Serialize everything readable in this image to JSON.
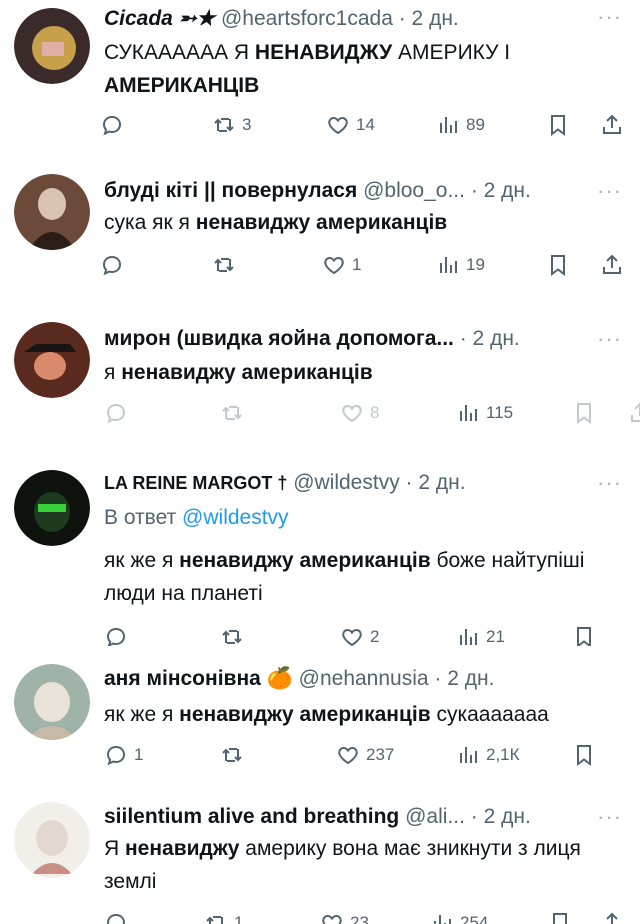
{
  "ui": {
    "more": "···"
  },
  "tweets": [
    {
      "name": "Cicada ➵★",
      "handle": "@heartsforc1cada",
      "time": "· 2 дн.",
      "text_parts": [
        "СУКАААААА Я ",
        "НЕНАВИДЖУ",
        " АМЕРИКУ І ",
        "АМЕРИКАНЦІВ",
        ""
      ],
      "replies": "",
      "retweets": "3",
      "likes": "14",
      "views": "89",
      "avatar_colors": [
        "#3b2a2a",
        "#c9a04a",
        "#e0b0a8"
      ]
    },
    {
      "name": "блуді кіті || повернулася",
      "handle": "@bloo_o...",
      "time": "· 2 дн.",
      "text_parts": [
        "сука як я ",
        "ненавиджу американців",
        ""
      ],
      "replies": "",
      "retweets": "",
      "likes": "1",
      "views": "19",
      "avatar_colors": [
        "#6b4a3a",
        "#d9c3b0",
        "#2b1e18"
      ]
    },
    {
      "name": "мирон (швидка яойна допомога...",
      "handle": "",
      "time": "· 2 дн.",
      "text_parts": [
        "я ",
        "ненавиджу американців",
        ""
      ],
      "replies": "",
      "retweets": "",
      "likes": "8",
      "views": "115",
      "avatar_colors": [
        "#5a2a1e",
        "#1a1414",
        "#d98a6a"
      ]
    },
    {
      "name": "LA REINE MARGOT †",
      "handle": "@wildestvy",
      "time": "· 2 дн.",
      "reply_prefix": "В ответ ",
      "reply_to": "@wildestvy",
      "text_parts": [
        "як же я ",
        "ненавиджу американців",
        " боже найтупіші люди на планеті"
      ],
      "replies": "",
      "retweets": "",
      "likes": "2",
      "views": "21",
      "avatar_colors": [
        "#0d120d",
        "#39d13a",
        "#1e3a1e"
      ]
    },
    {
      "name": "аня мінсонівна 🍊",
      "handle": "@nehannusia",
      "time": "· 2 дн.",
      "text_parts": [
        "як же я ",
        "ненавиджу американців",
        " сукааааааа"
      ],
      "replies": "1",
      "retweets": "",
      "likes": "237",
      "views": "2,1К",
      "avatar_colors": [
        "#9fb3a8",
        "#e8e2d8",
        "#c7b9a8"
      ]
    },
    {
      "name": "siilentium alive and breathing",
      "handle": "@ali...",
      "time": "· 2 дн.",
      "text_parts": [
        "Я ",
        "ненавиджу",
        " америку вона має зникнути з лиця землі"
      ],
      "replies": "",
      "retweets": "1",
      "likes": "23",
      "views": "254",
      "avatar_colors": [
        "#e3d8cf",
        "#c98f86",
        "#f2eeea"
      ]
    }
  ]
}
